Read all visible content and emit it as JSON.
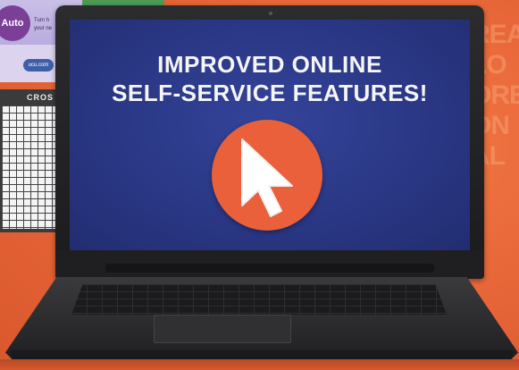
{
  "background": {
    "color": "#e9683a",
    "side_text": [
      "REA",
      "LO",
      "ORE",
      "ON",
      "AL"
    ]
  },
  "mailer": {
    "badge": "Auto",
    "line1": "Turn h",
    "line2": "your ne",
    "pill": "ucu.com"
  },
  "crossword": {
    "label": "CROS"
  },
  "screen": {
    "headline_line1": "IMPROVED ONLINE",
    "headline_line2": "SELF-SERVICE FEATURES!",
    "background_color": "#2a3785",
    "button_color": "#e9603a",
    "icon": "mouse-pointer-icon"
  }
}
